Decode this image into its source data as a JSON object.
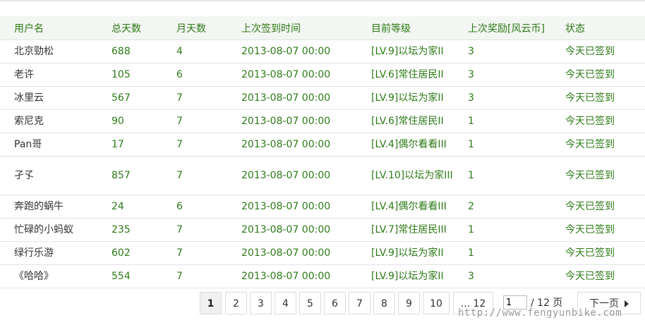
{
  "table": {
    "headers": [
      "用户名",
      "总天数",
      "月天数",
      "上次签到时间",
      "目前等级",
      "上次奖励[风云币]",
      "状态"
    ],
    "rows": [
      {
        "user": "北京勁松",
        "total": "688",
        "month": "4",
        "time": "2013-08-07 00:00",
        "level": "[LV.9]以坛为家II",
        "reward": "3",
        "status": "今天已签到"
      },
      {
        "user": "老许",
        "total": "105",
        "month": "6",
        "time": "2013-08-07 00:00",
        "level": "[LV.6]常住居民II",
        "reward": "3",
        "status": "今天已签到"
      },
      {
        "user": "冰里云",
        "total": "567",
        "month": "7",
        "time": "2013-08-07 00:00",
        "level": "[LV.9]以坛为家II",
        "reward": "3",
        "status": "今天已签到"
      },
      {
        "user": "索尼克",
        "total": "90",
        "month": "7",
        "time": "2013-08-07 00:00",
        "level": "[LV.6]常住居民II",
        "reward": "1",
        "status": "今天已签到"
      },
      {
        "user": "Pan哥",
        "total": "17",
        "month": "7",
        "time": "2013-08-07 00:00",
        "level": "[LV.4]偶尔看看III",
        "reward": "1",
        "status": "今天已签到"
      },
      {
        "user": "孑孓",
        "total": "857",
        "month": "7",
        "time": "2013-08-07 00:00",
        "level": "[LV.10]以坛为家III",
        "reward": "1",
        "status": "今天已签到"
      },
      {
        "user": "奔跑的蜗牛",
        "total": "24",
        "month": "6",
        "time": "2013-08-07 00:00",
        "level": "[LV.4]偶尔看看III",
        "reward": "2",
        "status": "今天已签到"
      },
      {
        "user": "忙碌的小蚂蚁",
        "total": "235",
        "month": "7",
        "time": "2013-08-07 00:00",
        "level": "[LV.7]常住居民III",
        "reward": "1",
        "status": "今天已签到"
      },
      {
        "user": "绿行乐游",
        "total": "602",
        "month": "7",
        "time": "2013-08-07 00:00",
        "level": "[LV.9]以坛为家II",
        "reward": "1",
        "status": "今天已签到"
      },
      {
        "user": "《哈哈》",
        "total": "554",
        "month": "7",
        "time": "2013-08-07 00:00",
        "level": "[LV.9]以坛为家II",
        "reward": "3",
        "status": "今天已签到"
      }
    ]
  },
  "pagination": {
    "current": "1",
    "pages": [
      "2",
      "3",
      "4",
      "5",
      "6",
      "7",
      "8",
      "9",
      "10"
    ],
    "last": "... 12",
    "input_value": "1",
    "total": "/ 12 页",
    "next": "下一页",
    "next_icon": "triangle-right-icon"
  },
  "watermark": "http://www.fengyunbike.com",
  "colors": {
    "text_green": "#2c7a16",
    "header_bg": "#f3f6f2",
    "border": "#e2e2e2"
  }
}
